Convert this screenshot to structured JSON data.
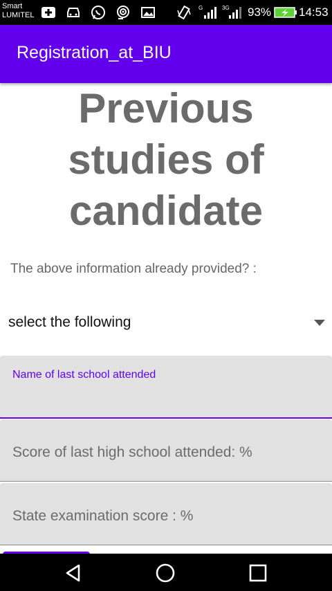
{
  "status_bar": {
    "carrier_line1": "Smart",
    "carrier_line2": "LUMITEL",
    "icons": [
      "medical-plus-icon",
      "car-icon",
      "whatsapp-icon",
      "hotspot-icon",
      "image-icon",
      "vibrate-icon",
      "signal-g-icon",
      "signal-3g-icon",
      "battery-charging-icon"
    ],
    "network_g": "G",
    "network_3g": "3G",
    "battery": "93%",
    "time": "14:53"
  },
  "app_bar": {
    "title": "Registration_at_BIU",
    "color": "#6200ee"
  },
  "main": {
    "heading_lines": [
      "Previous",
      "studies of",
      "candidate"
    ],
    "question": "The above information already provided? :",
    "spinner": {
      "selected": "select the following"
    },
    "fields": {
      "school_name": {
        "label": "Name of last school attended",
        "value": ""
      },
      "high_school_score": {
        "placeholder": "Score of last high school attended: %"
      },
      "state_exam_score": {
        "placeholder": "State examination score : %"
      }
    }
  },
  "nav_bar": {
    "buttons": [
      "back-icon",
      "home-icon",
      "recents-icon"
    ]
  }
}
